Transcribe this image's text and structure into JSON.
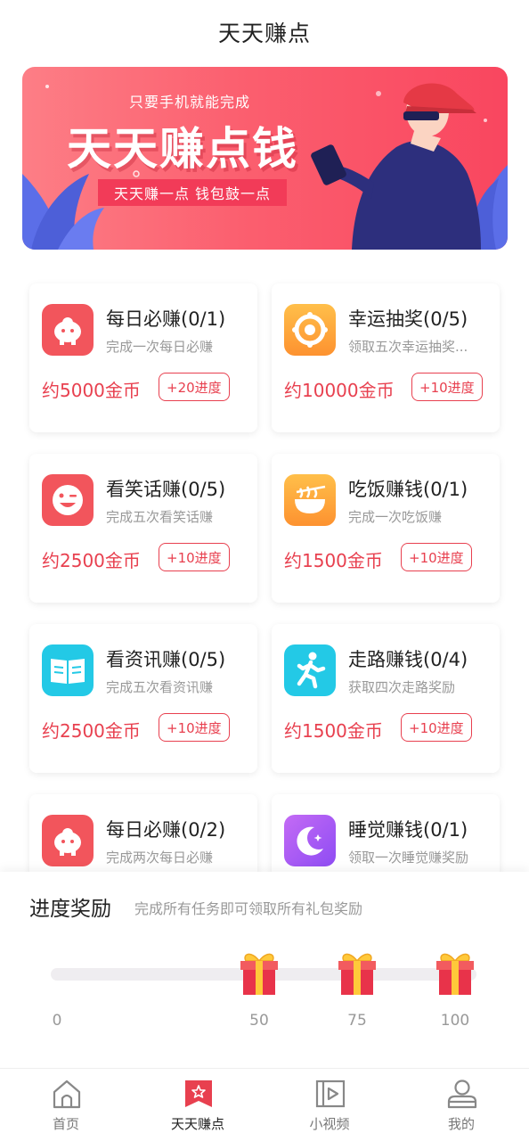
{
  "header": {
    "title": "天天赚点"
  },
  "banner": {
    "subtitle": "只要手机就能完成",
    "headline": "天天赚点钱",
    "slogan": "天天赚一点  钱包鼓一点"
  },
  "tasks": [
    {
      "title": "每日必赚(0/1)",
      "desc": "完成一次每日必赚",
      "coins": "约5000金币",
      "progress": "+20进度",
      "icon": "piggy-bank-icon"
    },
    {
      "title": "幸运抽奖(0/5)",
      "desc": "领取五次幸运抽奖...",
      "coins": "约10000金币",
      "progress": "+10进度",
      "icon": "lottery-wheel-icon"
    },
    {
      "title": "看笑话赚(0/5)",
      "desc": "完成五次看笑话赚",
      "coins": "约2500金币",
      "progress": "+10进度",
      "icon": "wink-face-icon"
    },
    {
      "title": "吃饭赚钱(0/1)",
      "desc": "完成一次吃饭赚",
      "coins": "约1500金币",
      "progress": "+10进度",
      "icon": "noodle-bowl-icon"
    },
    {
      "title": "看资讯赚(0/5)",
      "desc": "完成五次看资讯赚",
      "coins": "约2500金币",
      "progress": "+10进度",
      "icon": "book-icon"
    },
    {
      "title": "走路赚钱(0/4)",
      "desc": "获取四次走路奖励",
      "coins": "约1500金币",
      "progress": "+10进度",
      "icon": "walking-person-icon"
    },
    {
      "title": "每日必赚(0/2)",
      "desc": "完成两次每日必赚",
      "coins": "",
      "progress": "",
      "icon": "piggy-bank-icon"
    },
    {
      "title": "睡觉赚钱(0/1)",
      "desc": "领取一次睡觉赚奖励",
      "coins": "",
      "progress": "",
      "icon": "moon-icon"
    }
  ],
  "rewards": {
    "title": "进度奖励",
    "desc": "完成所有任务即可领取所有礼包奖励",
    "progress_value": 0,
    "ticks": [
      "0",
      "50",
      "75",
      "100"
    ]
  },
  "nav": {
    "items": [
      {
        "label": "首页",
        "icon": "home-icon"
      },
      {
        "label": "天天赚点",
        "icon": "bookmark-star-icon"
      },
      {
        "label": "小视频",
        "icon": "video-play-icon"
      },
      {
        "label": "我的",
        "icon": "user-icon"
      }
    ],
    "active_index": 1
  },
  "colors": {
    "accent": "#e8404f",
    "banner": "#fb5f6f",
    "red_icon": "#f2555c",
    "orange_icon": "#fdaa3a",
    "cyan_icon": "#23c9e6",
    "purple_icon": "#a55bf5"
  }
}
